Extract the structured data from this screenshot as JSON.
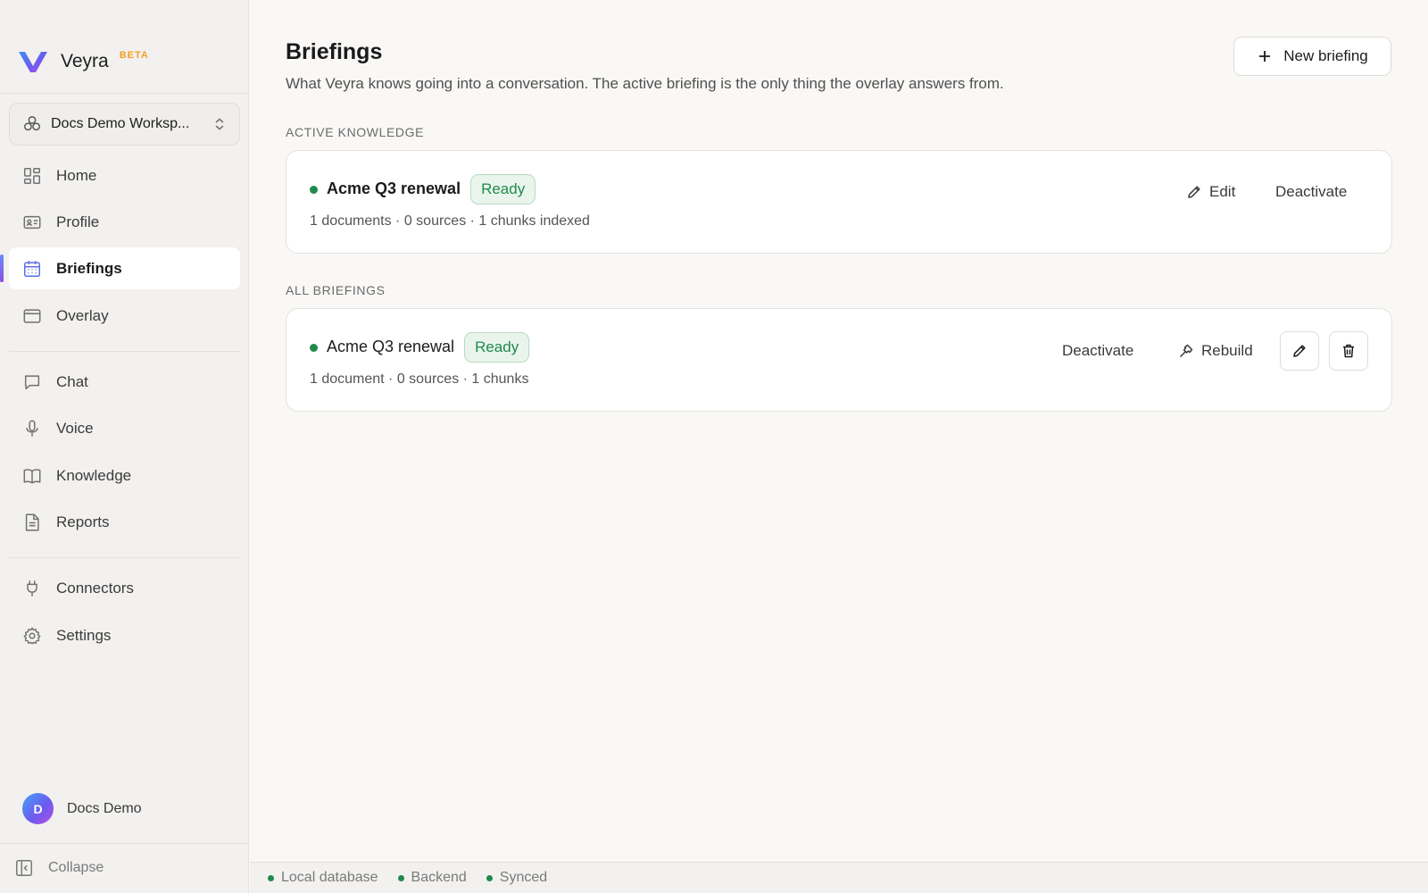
{
  "app": {
    "name": "Veyra",
    "badge": "BETA",
    "accent_color": "#5a6fe8",
    "beta_color": "#f29f26"
  },
  "workspace": {
    "label": "Docs Demo Worksp...",
    "icon": "workspace-icon"
  },
  "sidebar": {
    "items": [
      {
        "label": "Home",
        "icon": "dashboard-icon"
      },
      {
        "label": "Profile",
        "icon": "id-card-icon"
      },
      {
        "label": "Briefings",
        "icon": "calendar-icon",
        "active": true
      },
      {
        "label": "Overlay",
        "icon": "window-icon"
      },
      {
        "label": "Chat",
        "icon": "chat-icon"
      },
      {
        "label": "Voice",
        "icon": "microphone-icon"
      },
      {
        "label": "Knowledge",
        "icon": "book-icon"
      },
      {
        "label": "Reports",
        "icon": "document-icon"
      },
      {
        "label": "Connectors",
        "icon": "plug-icon"
      },
      {
        "label": "Settings",
        "icon": "gear-icon"
      }
    ],
    "user": {
      "initial": "D",
      "name": "Docs Demo"
    },
    "collapse_label": "Collapse"
  },
  "page": {
    "title": "Briefings",
    "subtitle": "What Veyra knows going into a conversation. The active briefing is the only thing the overlay answers from.",
    "new_button": "New briefing"
  },
  "active_section": {
    "label": "ACTIVE KNOWLEDGE",
    "card": {
      "title": "Acme Q3 renewal",
      "status": "Ready",
      "meta": "1 documents · 0 sources · 1 chunks indexed",
      "edit_label": "Edit",
      "deactivate_label": "Deactivate"
    }
  },
  "all_section": {
    "label": "ALL BRIEFINGS",
    "card": {
      "title": "Acme Q3 renewal",
      "status": "Ready",
      "meta": "1 document · 0 sources · 1 chunks",
      "deactivate_label": "Deactivate",
      "rebuild_label": "Rebuild"
    }
  },
  "statusbar": {
    "items": [
      {
        "label": "Local database",
        "color": "#1f8a4c"
      },
      {
        "label": "Backend",
        "color": "#1f8a4c"
      },
      {
        "label": "Synced",
        "color": "#1f8a4c"
      }
    ]
  }
}
